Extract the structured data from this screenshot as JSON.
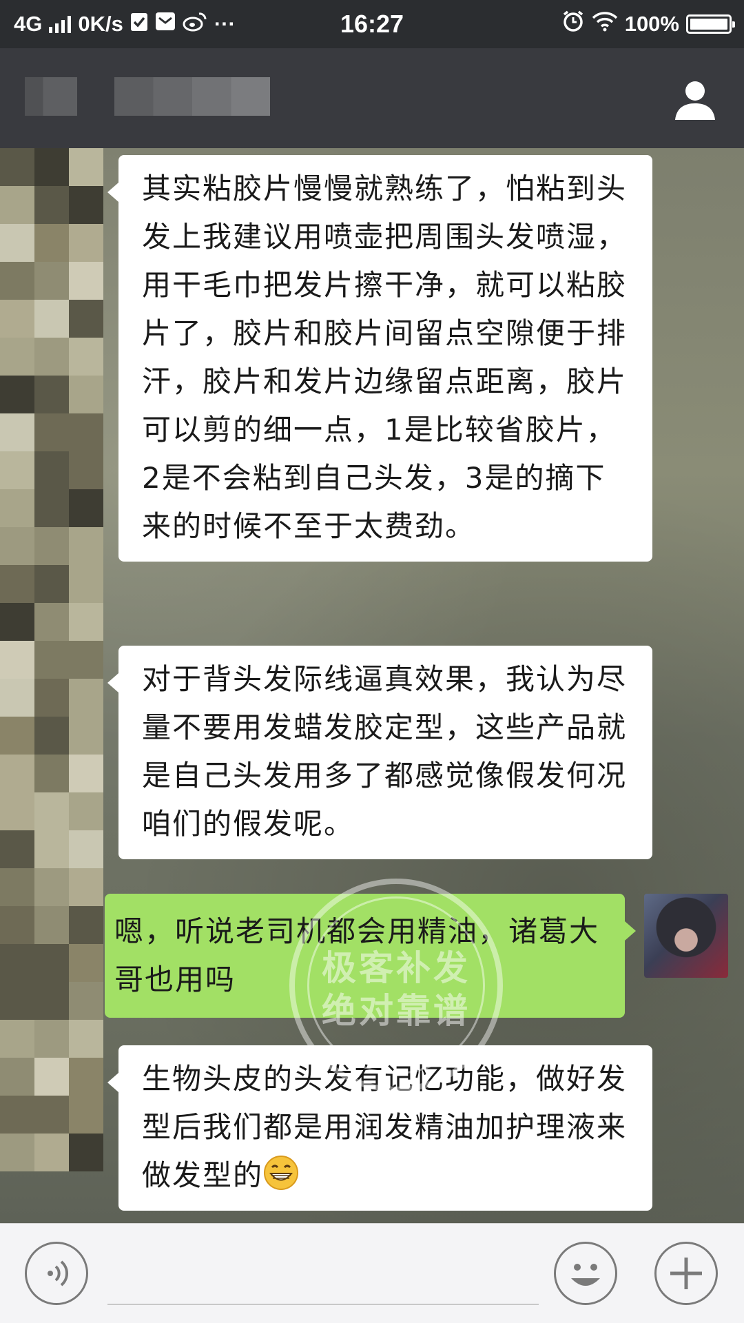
{
  "status_bar": {
    "network": "4G",
    "speed": "0K/s",
    "more": "···",
    "time": "16:27",
    "battery_text": "100%",
    "battery_level": 1.0,
    "icons": [
      "signal-icon",
      "check-icon",
      "mail-icon",
      "weibo-icon",
      "alarm-icon",
      "wifi-icon",
      "battery-icon"
    ]
  },
  "header": {
    "icons": [
      "profile-icon"
    ]
  },
  "messages": [
    {
      "direction": "incoming",
      "text": "其实粘胶片慢慢就熟练了，怕粘到头发上我建议用喷壶把周围头发喷湿，用干毛巾把发片擦干净，就可以粘胶片了，胶片和胶片间留点空隙便于排汗，胶片和发片边缘留点距离，胶片可以剪的细一点，1是比较省胶片，2是不会粘到自己头发，3是的摘下来的时候不至于太费劲。"
    },
    {
      "direction": "incoming",
      "text": "对于背头发际线逼真效果，我认为尽量不要用发蜡发胶定型，这些产品就是自己头发用多了都感觉像假发何况咱们的假发呢。"
    },
    {
      "direction": "outgoing",
      "text": "嗯，听说老司机都会用精油，诸葛大哥也用吗"
    },
    {
      "direction": "incoming",
      "text": "生物头皮的头发有记忆功能，做好发型后我们都是用润发精油加护理液来做发型的",
      "emoji": "grin-emoji"
    }
  ],
  "watermark": {
    "line1": "极客补发",
    "line2": "绝对靠谱",
    "line3": "上门补发快乐到家"
  },
  "input_bar": {
    "value": "",
    "icons": [
      "voice-icon",
      "emoji-icon",
      "plus-icon"
    ]
  },
  "colors": {
    "status_bg": "#2b2d30",
    "title_bg": "#393a3f",
    "incoming_bubble": "#ffffff",
    "outgoing_bubble": "#a2e065",
    "input_bg": "#f4f4f6"
  }
}
